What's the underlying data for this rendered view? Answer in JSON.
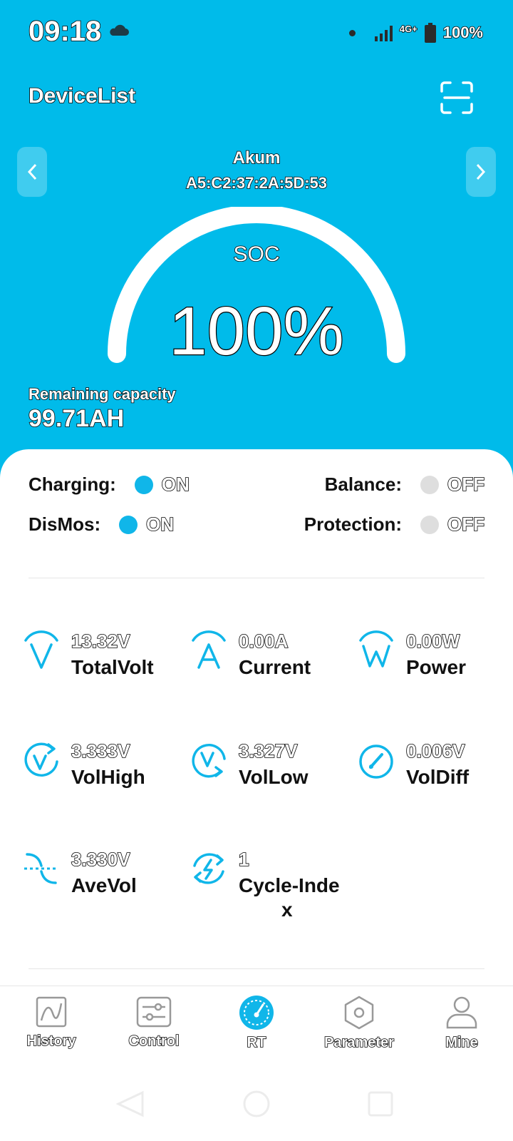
{
  "status": {
    "time": "09:18",
    "network": "4G+",
    "battery": "100%"
  },
  "header": {
    "title": "DeviceList"
  },
  "device": {
    "name": "Akum",
    "mac": "A5:C2:37:2A:5D:53"
  },
  "soc": {
    "label": "SOC",
    "value": "100%",
    "level": 1.0
  },
  "remaining": {
    "label": "Remaining capacity",
    "value": "99.71AH"
  },
  "states": [
    {
      "label": "Charging:",
      "value": "ON"
    },
    {
      "label": "Balance:",
      "value": "OFF"
    },
    {
      "label": "DisMos:",
      "value": "ON"
    },
    {
      "label": "Protection:",
      "value": "OFF"
    }
  ],
  "metrics": [
    {
      "value": "13.32V",
      "label": "TotalVolt",
      "icon": "voltage-icon"
    },
    {
      "value": "0.00A",
      "label": "Current",
      "icon": "current-icon"
    },
    {
      "value": "0.00W",
      "label": "Power",
      "icon": "power-icon"
    },
    {
      "value": "3.333V",
      "label": "VolHigh",
      "icon": "volhigh-icon"
    },
    {
      "value": "3.327V",
      "label": "VolLow",
      "icon": "vollow-icon"
    },
    {
      "value": "0.006V",
      "label": "VolDiff",
      "icon": "gauge-icon"
    },
    {
      "value": "3.330V",
      "label": "AveVol",
      "icon": "average-icon"
    },
    {
      "value": "1",
      "label": "Cycle-Inde",
      "label2": "x",
      "icon": "cycle-icon"
    }
  ],
  "tabs": [
    {
      "label": "History",
      "icon": "history-icon"
    },
    {
      "label": "Control",
      "icon": "control-icon"
    },
    {
      "label": "RT",
      "icon": "rt-icon",
      "active": true
    },
    {
      "label": "Parameter",
      "icon": "parameter-icon"
    },
    {
      "label": "Mine",
      "icon": "user-icon"
    }
  ],
  "colors": {
    "accent": "#00bbea",
    "on": "#10b6e9",
    "off": "#dedede"
  }
}
